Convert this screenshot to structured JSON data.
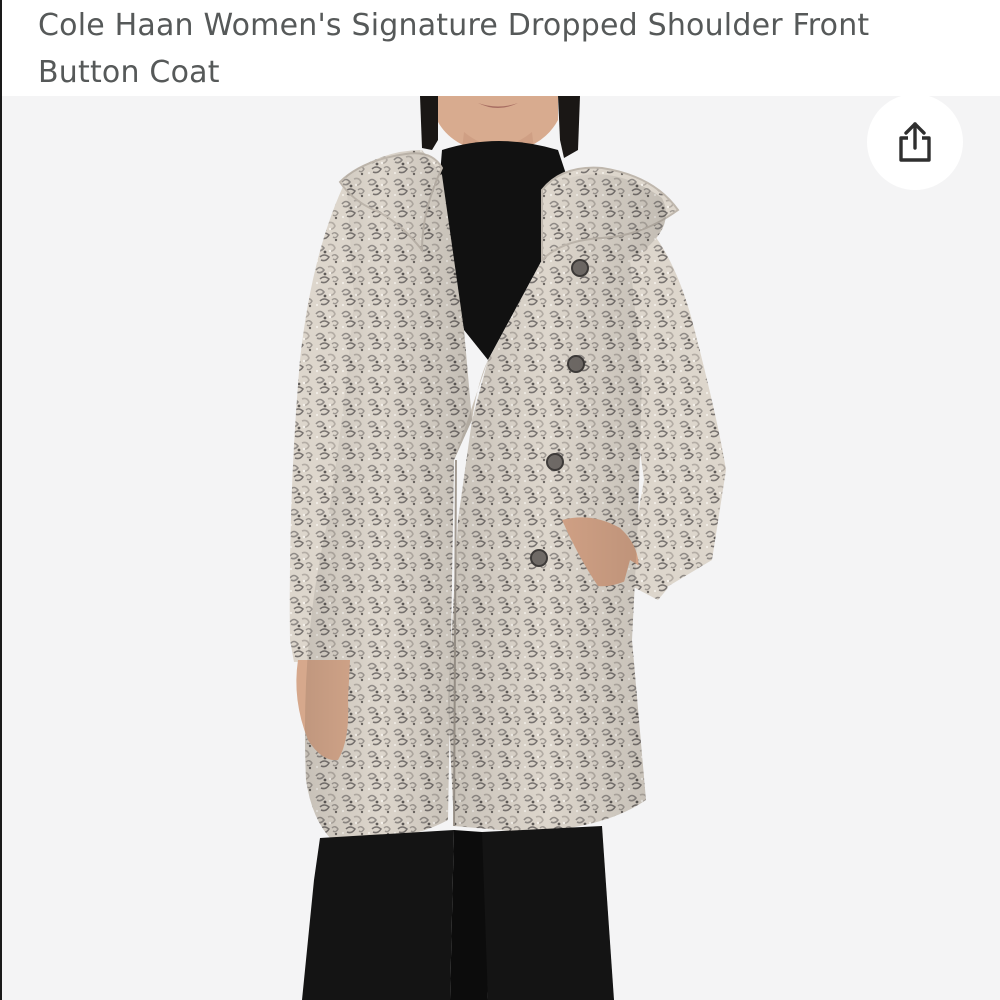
{
  "product": {
    "title": "Cole Haan Women's Signature Dropped Shoulder Front Button Coat"
  },
  "image": {
    "subject": "product-photo"
  },
  "share": {
    "icon": "share-icon"
  },
  "colors": {
    "title_text": "#565959",
    "image_background": "#f4f4f5",
    "coat": "#d9d2c8",
    "turtleneck": "#111111",
    "pants": "#141414"
  }
}
